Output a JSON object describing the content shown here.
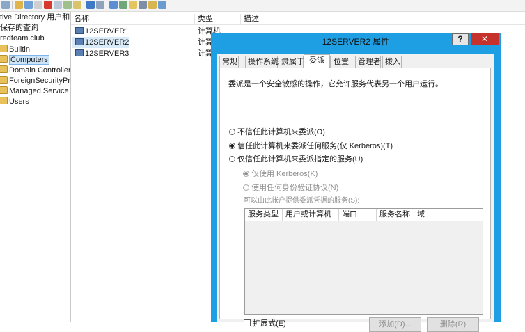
{
  "tree": {
    "items": [
      {
        "label": "tive Directory 用户和"
      },
      {
        "label": "保存的查询"
      },
      {
        "label": "redteam.club"
      },
      {
        "label": "Builtin"
      },
      {
        "label": "Computers"
      },
      {
        "label": "Domain Controller"
      },
      {
        "label": "ForeignSecurityPr"
      },
      {
        "label": "Managed Service"
      },
      {
        "label": "Users"
      }
    ]
  },
  "list": {
    "columns": [
      "名称",
      "类型",
      "描述"
    ],
    "rows": [
      {
        "name": "12SERVER1",
        "type": "计算机"
      },
      {
        "name": "12SERVER2",
        "type": "计算"
      },
      {
        "name": "12SERVER3",
        "type": "计算"
      }
    ]
  },
  "dialog": {
    "title": "12SERVER2 属性",
    "help_label": "?",
    "close_label": "✕",
    "tabs": [
      "常规",
      "操作系统",
      "隶属于",
      "委派",
      "位置",
      "管理者",
      "拨入"
    ],
    "active_tab": "委派",
    "description": "委派是一个安全敏感的操作，它允许服务代表另一个用户运行。",
    "options": {
      "no_trust": "不信任此计算机来委派(O)",
      "trust_any": "信任此计算机来委派任何服务(仅 Kerberos)(T)",
      "trust_specified": "仅信任此计算机来委派指定的服务(U)"
    },
    "sub_options": {
      "kerberos_only": "仅使用 Kerberos(K)",
      "any_protocol": "使用任何身份验证协议(N)"
    },
    "services_label": "可以由此帐户提供委派凭据的服务(S):",
    "service_columns": [
      "服务类型",
      "用户或计算机",
      "端口",
      "服务名称",
      "域"
    ],
    "expanded_label": "扩展式(E)",
    "add_button": "添加(D)...",
    "remove_button": "删除(R)"
  },
  "colors": {
    "dialog_frame": "#1e9fe4",
    "close_button": "#c7312b",
    "selection": "#cce4f7"
  }
}
